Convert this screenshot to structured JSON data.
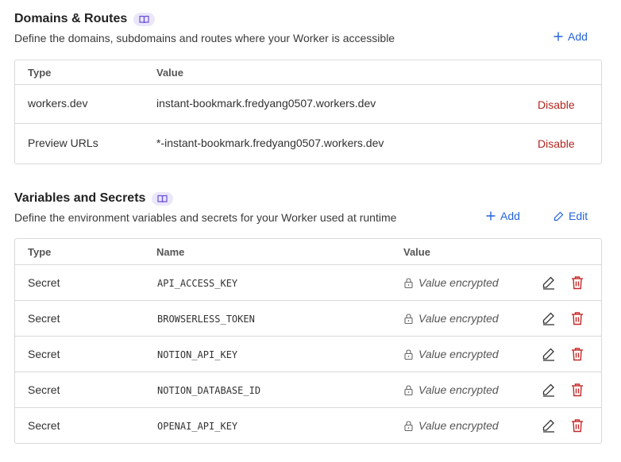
{
  "domains": {
    "title": "Domains & Routes",
    "description": "Define the domains, subdomains and routes where your Worker is accessible",
    "add_label": "Add",
    "columns": [
      "Type",
      "Value"
    ],
    "rows": [
      {
        "type": "workers.dev",
        "value": "instant-bookmark.fredyang0507.workers.dev",
        "action": "Disable"
      },
      {
        "type": "Preview URLs",
        "value": "*-instant-bookmark.fredyang0507.workers.dev",
        "action": "Disable"
      }
    ]
  },
  "variables": {
    "title": "Variables and Secrets",
    "description": "Define the environment variables and secrets for your Worker used at runtime",
    "add_label": "Add",
    "edit_label": "Edit",
    "columns": [
      "Type",
      "Name",
      "Value"
    ],
    "rows": [
      {
        "type": "Secret",
        "name": "API_ACCESS_KEY",
        "value": "Value encrypted"
      },
      {
        "type": "Secret",
        "name": "BROWSERLESS_TOKEN",
        "value": "Value encrypted"
      },
      {
        "type": "Secret",
        "name": "NOTION_API_KEY",
        "value": "Value encrypted"
      },
      {
        "type": "Secret",
        "name": "NOTION_DATABASE_ID",
        "value": "Value encrypted"
      },
      {
        "type": "Secret",
        "name": "OPENAI_API_KEY",
        "value": "Value encrypted"
      }
    ]
  },
  "colors": {
    "accent": "#2563d9",
    "danger": "#b3261e",
    "badge_bg": "#ebe7fb",
    "badge_icon": "#6b4fd8",
    "border": "#d9d9d9"
  },
  "icons": {
    "docs": "book-icon",
    "add": "plus-icon",
    "edit": "pencil-icon",
    "lock": "lock-icon",
    "delete": "trash-icon"
  }
}
